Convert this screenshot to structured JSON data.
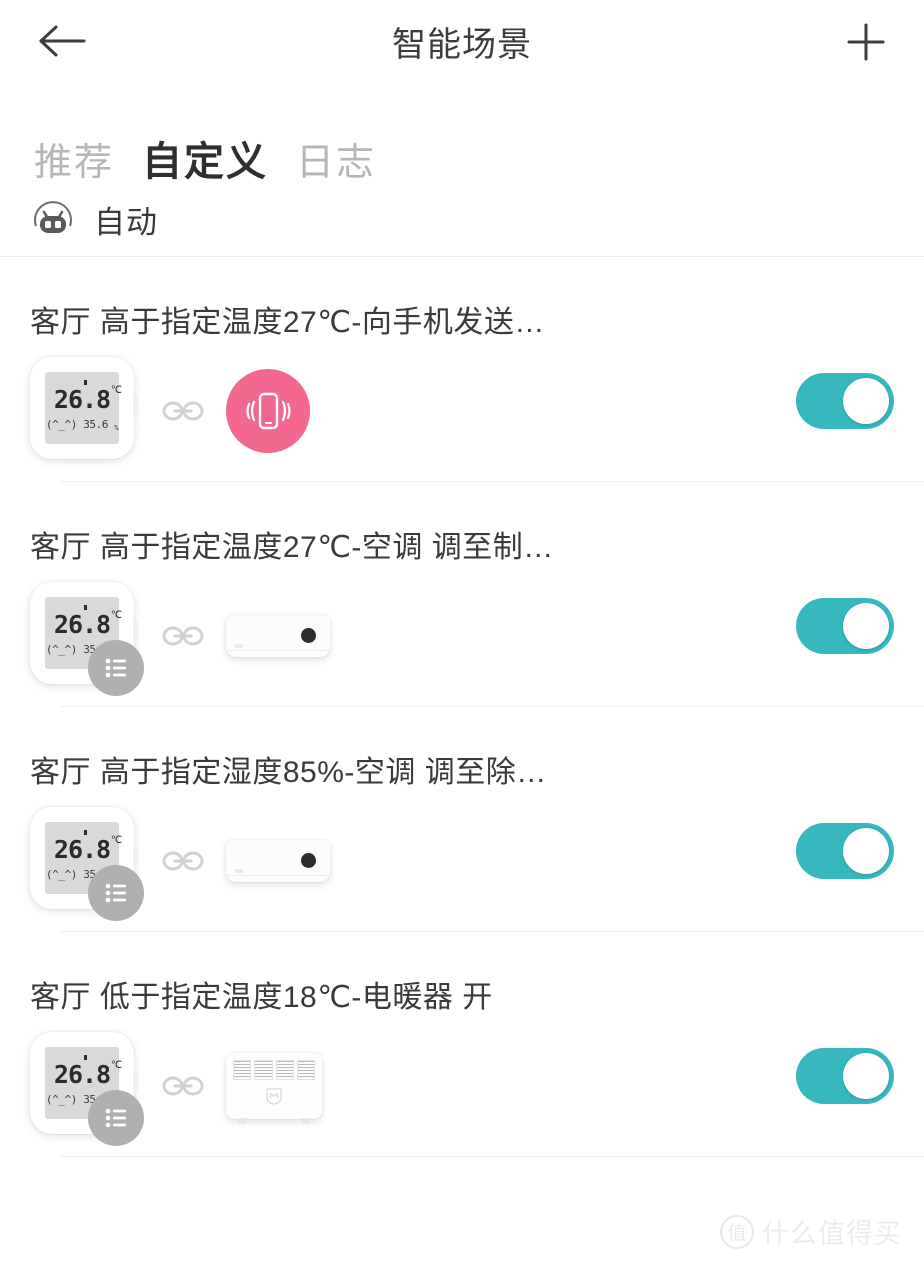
{
  "header": {
    "title": "智能场景",
    "back_icon": "arrow-left-icon",
    "add_icon": "plus-icon"
  },
  "tabs": [
    {
      "label": "推荐",
      "active": false
    },
    {
      "label": "自定义",
      "active": true
    },
    {
      "label": "日志",
      "active": false
    }
  ],
  "section": {
    "icon": "robot-icon",
    "label": "自动"
  },
  "colors": {
    "toggle_on": "#37b8bf",
    "phone_badge": "#f2688e",
    "list_badge": "#b0b0b0",
    "active_tab": "#2f2f2f",
    "inactive_tab": "#b6b6b6"
  },
  "sensor": {
    "temperature": "26.8",
    "temperature_unit": "℃",
    "face": "(^_^)",
    "humidity": "35.6",
    "humidity_unit": "%"
  },
  "scenes": [
    {
      "title": "客厅 高于指定温度27℃-向手机发送…",
      "trigger_icon": "temperature-humidity-sensor-icon",
      "has_list_badge": false,
      "link_icon": "link-chain-icon",
      "action_icon": "phone-vibrate-icon",
      "action_type": "phone",
      "toggle_state": "on"
    },
    {
      "title": "客厅 高于指定温度27℃-空调 调至制…",
      "trigger_icon": "temperature-humidity-sensor-icon",
      "has_list_badge": true,
      "list_badge_icon": "list-icon",
      "link_icon": "link-chain-icon",
      "action_icon": "air-conditioner-icon",
      "action_type": "ac",
      "toggle_state": "on"
    },
    {
      "title": "客厅 高于指定湿度85%-空调 调至除…",
      "trigger_icon": "temperature-humidity-sensor-icon",
      "has_list_badge": true,
      "list_badge_icon": "list-icon",
      "link_icon": "link-chain-icon",
      "action_icon": "air-conditioner-icon",
      "action_type": "ac",
      "toggle_state": "on"
    },
    {
      "title": "客厅 低于指定温度18℃-电暖器 开",
      "trigger_icon": "temperature-humidity-sensor-icon",
      "has_list_badge": true,
      "list_badge_icon": "list-icon",
      "link_icon": "link-chain-icon",
      "action_icon": "electric-heater-icon",
      "action_type": "heater",
      "toggle_state": "on"
    }
  ],
  "watermark": {
    "badge": "值",
    "text": "什么值得买"
  }
}
